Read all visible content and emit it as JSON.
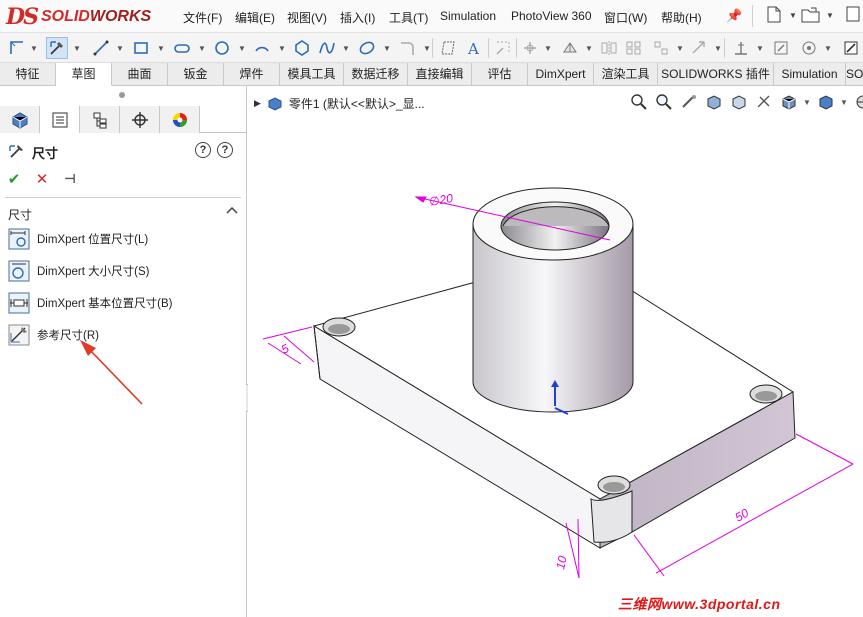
{
  "app": {
    "logo_ds": "DS",
    "logo_brand_light": "SOLID",
    "logo_brand_bold": "WORKS",
    "brand_color": "#d42a2a"
  },
  "menu": [
    {
      "label": "文件(F)"
    },
    {
      "label": "编辑(E)"
    },
    {
      "label": "视图(V)"
    },
    {
      "label": "插入(I)"
    },
    {
      "label": "工具(T)"
    },
    {
      "label": "Simulation"
    },
    {
      "label": "PhotoView 360"
    },
    {
      "label": "窗口(W)"
    },
    {
      "label": "帮助(H)"
    }
  ],
  "quick_access": [
    "new-document-icon",
    "open-folder-icon",
    "pin-icon"
  ],
  "sketch_toolbar_icons": [
    "smart-dimension-icon",
    "sketch-icon",
    "line-icon",
    "rectangle-icon",
    "slot-icon",
    "circle-icon",
    "arc-icon",
    "polygon-icon",
    "spline-icon",
    "ellipse-icon",
    "fillet-icon",
    "plane-icon",
    "text-icon",
    "trim-icon",
    "convert-entities-icon",
    "offset-icon",
    "mirror-icon",
    "linear-pattern-icon",
    "move-entities-icon",
    "display-relations-icon",
    "repair-sketch-icon",
    "quick-snaps-icon",
    "shaded-sketch-icon"
  ],
  "command_tabs": [
    {
      "label": "特征"
    },
    {
      "label": "草图"
    },
    {
      "label": "曲面"
    },
    {
      "label": "钣金"
    },
    {
      "label": "焊件"
    },
    {
      "label": "模具工具"
    },
    {
      "label": "数据迁移"
    },
    {
      "label": "直接编辑"
    },
    {
      "label": "评估"
    },
    {
      "label": "DimXpert"
    },
    {
      "label": "渲染工具"
    },
    {
      "label": "SOLIDWORKS 插件"
    },
    {
      "label": "Simulation"
    },
    {
      "label": "SO"
    }
  ],
  "active_tab_index": 1,
  "panel_tabs": [
    "feature-manager-icon",
    "property-manager-icon",
    "configuration-manager-icon",
    "dimxpert-manager-icon",
    "display-manager-icon"
  ],
  "property_manager": {
    "title": "尺寸",
    "help_label": "?",
    "section_title": "尺寸",
    "commands": [
      {
        "label": "DimXpert 位置尺寸(L)"
      },
      {
        "label": "DimXpert 大小尺寸(S)"
      },
      {
        "label": "DimXpert 基本位置尺寸(B)"
      },
      {
        "label": "参考尺寸(R)"
      }
    ]
  },
  "graphics": {
    "tree_item": "零件1  (默认<<默认>_显...",
    "dimensions": {
      "diameter": "∅20",
      "thickness_small": "5",
      "length": "50",
      "height": "10"
    },
    "watermark": "三维网www.3dportal.cn",
    "dim_color": "#e000e0",
    "arrow_color": "#e03a2a"
  }
}
